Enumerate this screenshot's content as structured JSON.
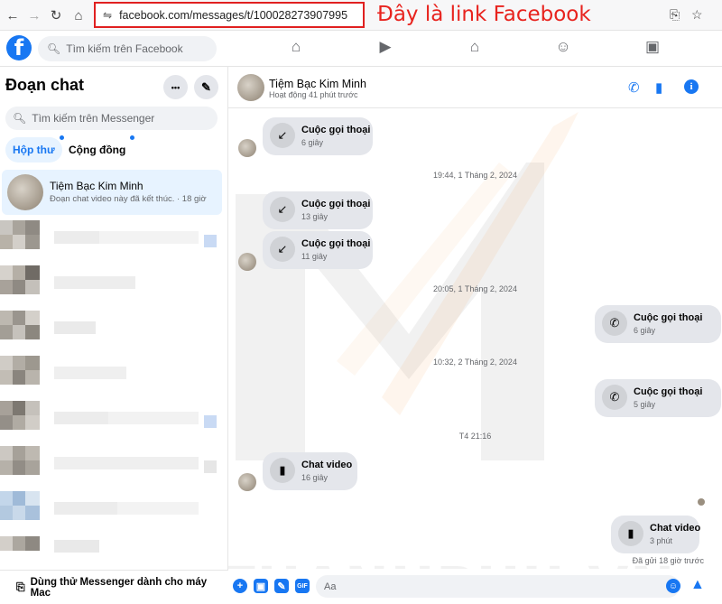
{
  "browser": {
    "url": "facebook.com/messages/t/100028273907995",
    "annotation": "Đây là link Facebook",
    "back_icon": "arrow-left-icon",
    "forward_icon": "arrow-right-icon",
    "reload_icon": "reload-icon",
    "home_icon": "home-icon",
    "install_icon": "install-app-icon",
    "bookmark_icon": "star-icon"
  },
  "fb_header": {
    "logo": "f",
    "search_placeholder": "Tìm kiếm trên Facebook",
    "nav": [
      "home-icon",
      "watch-icon",
      "marketplace-icon",
      "groups-icon",
      "gaming-icon"
    ]
  },
  "sidebar": {
    "title": "Đoạn chat",
    "more_label": "•••",
    "search_placeholder": "Tìm kiếm trên Messenger",
    "tabs": [
      {
        "label": "Hộp thư",
        "active": true
      },
      {
        "label": "Cộng đồng",
        "active": false
      }
    ],
    "active_conversation": {
      "name": "Tiệm Bạc Kim Minh",
      "preview": "Đoạn chat video này đã kết thúc. · 18 giờ"
    },
    "footer_label": "Dùng thử Messenger dành cho máy Mac"
  },
  "chat": {
    "contact_name": "Tiệm Bạc Kim Minh",
    "contact_status": "Hoạt động 41 phút trước",
    "watermark": "MAITHANHPHU.VN",
    "messages": [
      {
        "title": "Cuộc gọi thoại",
        "sub": "6 giây",
        "icon": "missed-call-icon"
      },
      {
        "title": "Cuộc gọi thoại",
        "sub": "13 giây",
        "icon": "missed-call-icon"
      },
      {
        "title": "Cuộc gọi thoại",
        "sub": "11 giây",
        "icon": "missed-call-icon"
      },
      {
        "title": "Cuộc gọi thoại",
        "sub": "6 giây",
        "icon": "outgoing-call-icon"
      },
      {
        "title": "Cuộc gọi thoại",
        "sub": "5 giây",
        "icon": "outgoing-call-icon"
      },
      {
        "title": "Chat video",
        "sub": "16 giây",
        "icon": "video-icon"
      },
      {
        "title": "Chat video",
        "sub": "3 phút",
        "icon": "video-outgoing-icon"
      }
    ],
    "timestamps": [
      "19:44, 1 Tháng 2, 2024",
      "20:05, 1 Tháng 2, 2024",
      "10:32, 2 Tháng 2, 2024",
      "T4 21:16"
    ],
    "sent_note": "Đã gửi 18 giờ trước",
    "compose_placeholder": "Aa"
  },
  "colors": {
    "accent": "#1877f2",
    "annotation_red": "#e8231e"
  }
}
